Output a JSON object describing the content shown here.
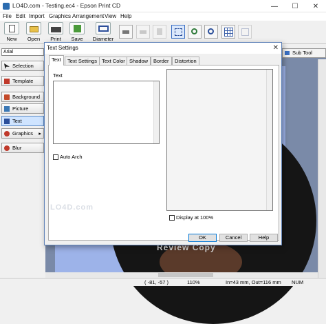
{
  "window": {
    "title": "LO4D.com - Testing.ec4 - Epson Print CD",
    "minimize_glyph": "—",
    "maximize_glyph": "☐",
    "close_glyph": "✕"
  },
  "menu": [
    "File",
    "Edit",
    "Import",
    "Graphics",
    "Arrangement",
    "View",
    "Help"
  ],
  "toolbar": {
    "new_label": "New",
    "open_label": "Open",
    "print_label": "Print",
    "save_label": "Save",
    "diameter_label": "Diameter"
  },
  "font_box": {
    "value": "Arial"
  },
  "left_panel": {
    "items": [
      "Selection",
      "Template",
      "Background",
      "Picture",
      "Text",
      "Graphics",
      "Blur"
    ],
    "active": "Text",
    "graphics_arrow": "▸"
  },
  "sub_tool_label": "Sub Tool",
  "canvas": {
    "disc_text": "Review Copy"
  },
  "watermark": "LO4D.com",
  "dialog": {
    "title": "Text Settings",
    "close_glyph": "✕",
    "tabs": [
      "Text",
      "Text Settings",
      "Text Color",
      "Shadow",
      "Border",
      "Distortion"
    ],
    "active_tab": "Text",
    "text_label": "Text",
    "auto_arch_label": "Auto Arch",
    "display_label": "Display at 100%",
    "ok_label": "OK",
    "cancel_label": "Cancel",
    "help_label": "Help"
  },
  "status": {
    "coords": "( -81, -57 )",
    "zoom": "110%",
    "dimensions": "In=43 mm, Out=116 mm",
    "num": "NUM"
  }
}
